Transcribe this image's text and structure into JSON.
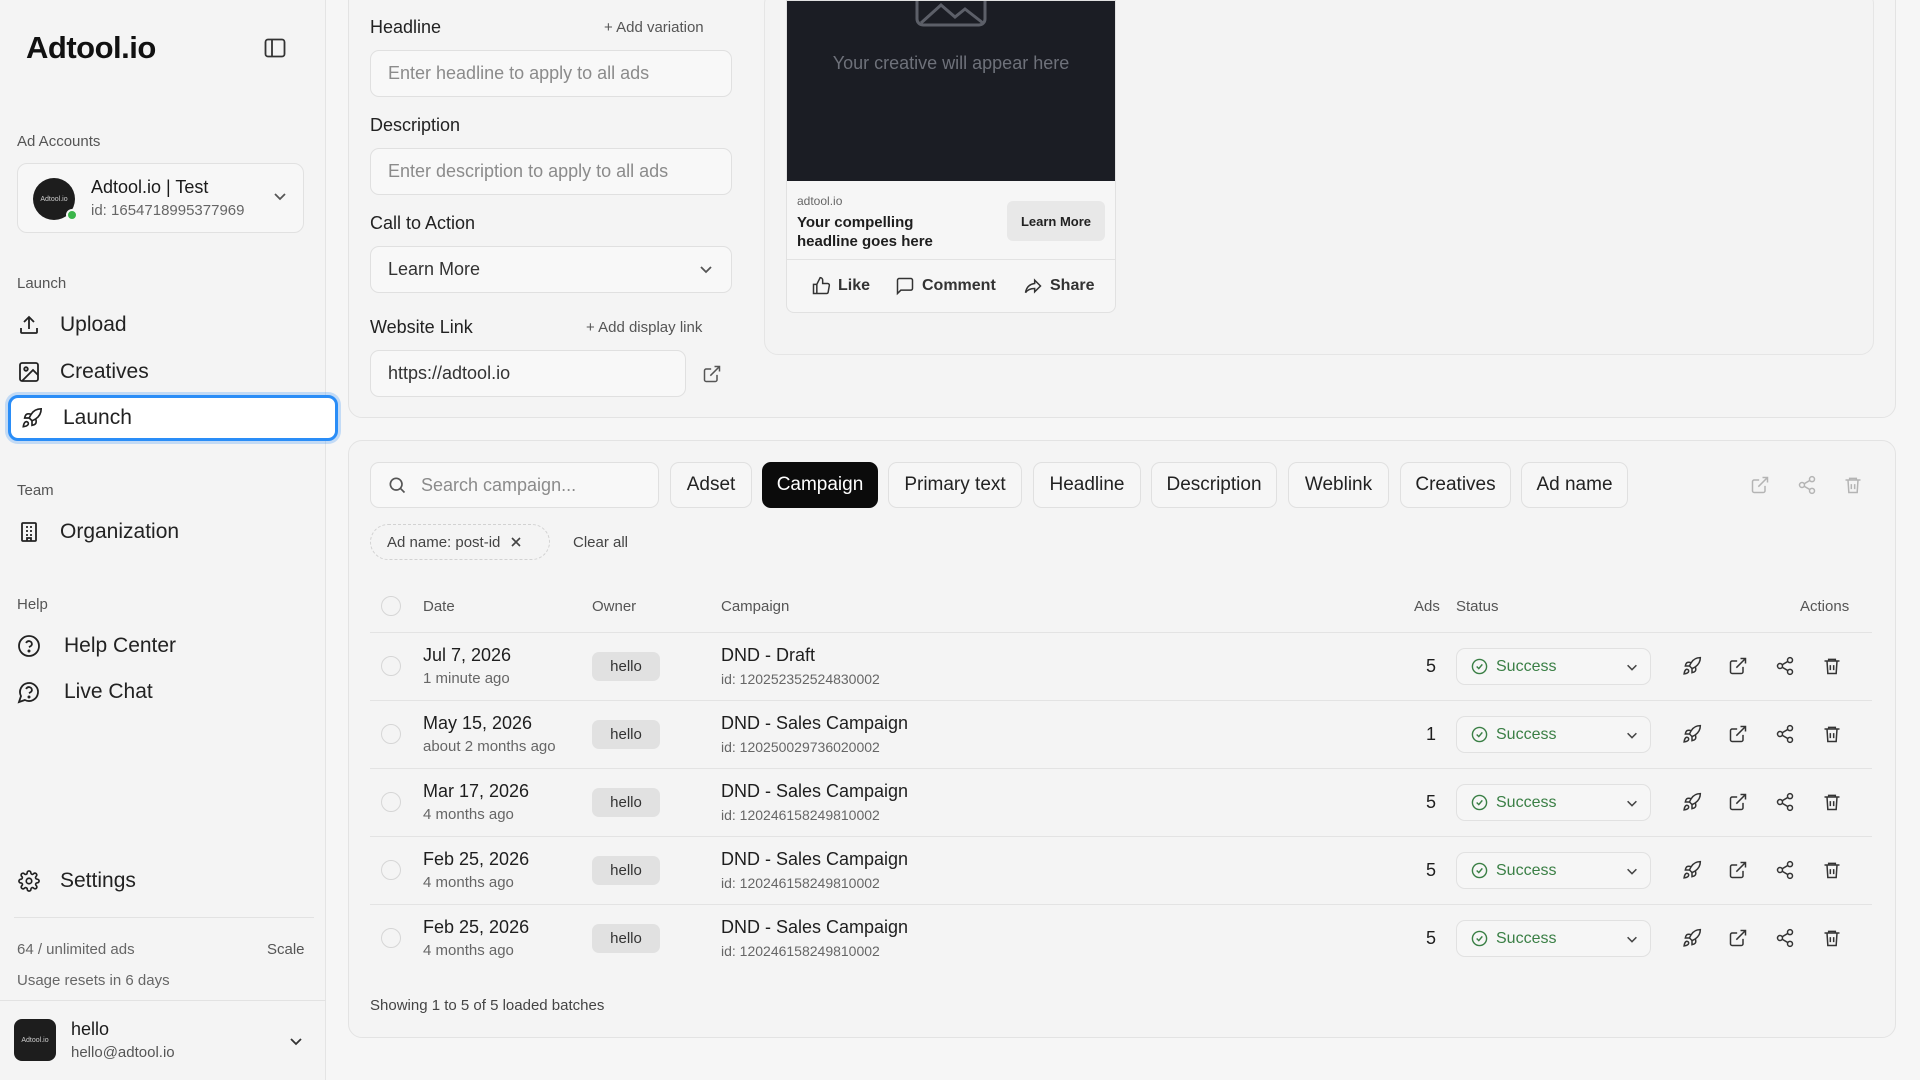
{
  "sidebar": {
    "logo": "Adtool.io",
    "ad_accounts_label": "Ad Accounts",
    "account": {
      "avatar_text": "Adtool.io",
      "name": "Adtool.io | Test",
      "id": "id: 1654718995377969"
    },
    "launch_label": "Launch",
    "nav_launch": [
      {
        "label": "Upload",
        "icon": "upload-icon"
      },
      {
        "label": "Creatives",
        "icon": "image-icon"
      },
      {
        "label": "Launch",
        "icon": "rocket-icon",
        "active": true
      }
    ],
    "team_label": "Team",
    "nav_team": [
      {
        "label": "Organization",
        "icon": "building-icon"
      }
    ],
    "help_label": "Help",
    "nav_help": [
      {
        "label": "Help Center",
        "icon": "help-circle-icon"
      },
      {
        "label": "Live Chat",
        "icon": "chat-icon"
      }
    ],
    "settings_label": "Settings",
    "usage": "64 / unlimited ads",
    "scale": "Scale",
    "usage_reset": "Usage resets in 6 days",
    "user": {
      "avatar_text": "Adtool.io",
      "name": "hello",
      "email": "hello@adtool.io"
    }
  },
  "form": {
    "headline_label": "Headline",
    "add_variation": "+ Add variation",
    "headline_placeholder": "Enter headline to apply to all ads",
    "description_label": "Description",
    "description_placeholder": "Enter description to apply to all ads",
    "cta_label": "Call to Action",
    "cta_value": "Learn More",
    "website_label": "Website Link",
    "add_display_link": "+ Add display link",
    "website_value": "https://adtool.io"
  },
  "preview": {
    "placeholder": "Your creative will appear here",
    "domain": "adtool.io",
    "headline": "Your compelling headline goes here",
    "cta": "Learn More",
    "like": "Like",
    "comment": "Comment",
    "share": "Share"
  },
  "table": {
    "search_placeholder": "Search campaign...",
    "chips": [
      "Adset",
      "Campaign",
      "Primary text",
      "Headline",
      "Description",
      "Weblink",
      "Creatives",
      "Ad name"
    ],
    "active_chip": "Campaign",
    "filter_pill": "Ad name: post-id",
    "clear_all": "Clear all",
    "headers": {
      "date": "Date",
      "owner": "Owner",
      "campaign": "Campaign",
      "ads": "Ads",
      "status": "Status",
      "actions": "Actions"
    },
    "rows": [
      {
        "date": "Jul 7, 2026",
        "ago": "1 minute ago",
        "owner": "hello",
        "campaign": "DND - Draft",
        "id": "id: 120252352524830002",
        "ads": "5",
        "status": "Success"
      },
      {
        "date": "May 15, 2026",
        "ago": "about 2 months ago",
        "owner": "hello",
        "campaign": "DND - Sales Campaign",
        "id": "id: 120250029736020002",
        "ads": "1",
        "status": "Success"
      },
      {
        "date": "Mar 17, 2026",
        "ago": "4 months ago",
        "owner": "hello",
        "campaign": "DND - Sales Campaign",
        "id": "id: 120246158249810002",
        "ads": "5",
        "status": "Success"
      },
      {
        "date": "Feb 25, 2026",
        "ago": "4 months ago",
        "owner": "hello",
        "campaign": "DND - Sales Campaign",
        "id": "id: 120246158249810002",
        "ads": "5",
        "status": "Success"
      },
      {
        "date": "Feb 25, 2026",
        "ago": "4 months ago",
        "owner": "hello",
        "campaign": "DND - Sales Campaign",
        "id": "id: 120246158249810002",
        "ads": "5",
        "status": "Success"
      }
    ],
    "footer": "Showing 1 to 5 of 5 loaded batches"
  },
  "colors": {
    "accent": "#2a8df7",
    "active_chip_bg": "#0b0b0b",
    "success": "#3a7f45",
    "online_dot": "#3bb54a"
  }
}
